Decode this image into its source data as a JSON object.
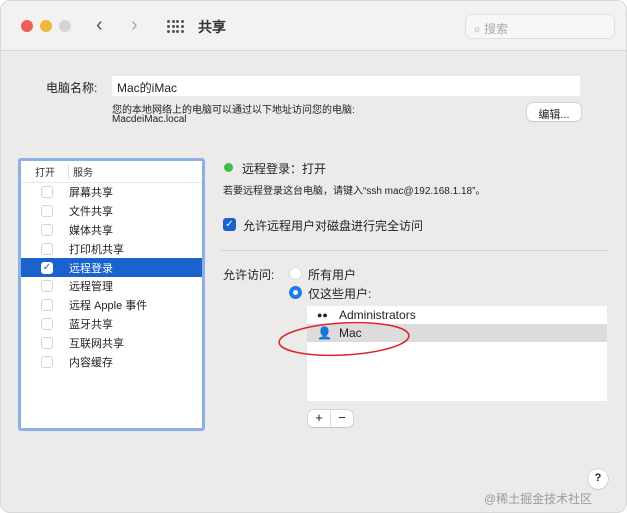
{
  "window": {
    "title": "共享",
    "search_placeholder": "搜索",
    "colors": {
      "close": "#ec5f57",
      "min": "#f0b83e",
      "max": "#d6d5d4",
      "accent": "#1a62cc",
      "status_on": "#3ebd4c"
    }
  },
  "computer": {
    "label": "电脑名称:",
    "name": "Mac的iMac",
    "hint": "您的本地网络上的电脑可以通过以下地址访问您的电脑:",
    "address": "MacdeiMac.local",
    "edit_label": "编辑..."
  },
  "services": {
    "col_on": "打开",
    "col_service": "服务",
    "items": [
      {
        "label": "屏幕共享",
        "checked": false
      },
      {
        "label": "文件共享",
        "checked": false
      },
      {
        "label": "媒体共享",
        "checked": false
      },
      {
        "label": "打印机共享",
        "checked": false
      },
      {
        "label": "远程登录",
        "checked": true
      },
      {
        "label": "远程管理",
        "checked": false
      },
      {
        "label": "远程 Apple 事件",
        "checked": false
      },
      {
        "label": "蓝牙共享",
        "checked": false
      },
      {
        "label": "互联网共享",
        "checked": false
      },
      {
        "label": "内容缓存",
        "checked": false
      }
    ]
  },
  "detail": {
    "status": "远程登录：打开",
    "instructions": "若要远程登录这台电脑，请键入“ssh mac@192.168.1.18”。",
    "full_disk": "允许远程用户对磁盘进行完全访问",
    "allow_label": "允许访问:",
    "opt_all": "所有用户",
    "opt_only": "仅这些用户:",
    "users": [
      "Administrators",
      "Mac"
    ],
    "add": "+",
    "remove": "−"
  },
  "help": "?",
  "watermark": "@稀土掘金技术社区"
}
